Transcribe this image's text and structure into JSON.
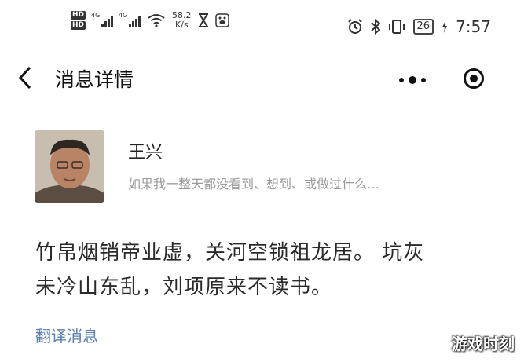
{
  "status_bar": {
    "hd_top": "HD",
    "hd_bottom": "HD",
    "net1": "4G",
    "net2": "4G",
    "speed_value": "58.2",
    "speed_unit": "K/s",
    "battery": "26",
    "time": "7:57"
  },
  "nav": {
    "title": "消息详情"
  },
  "sender": {
    "name": "王兴",
    "preview": "如果我一整天都没看到、想到、或做过什么…"
  },
  "message": {
    "line1": "竹帛烟销帝业虚，关河空锁祖龙居。 坑灰",
    "line2": "未冷山东乱，刘项原来不读书。",
    "translate_label": "翻译消息"
  },
  "watermark": "游戏时刻"
}
